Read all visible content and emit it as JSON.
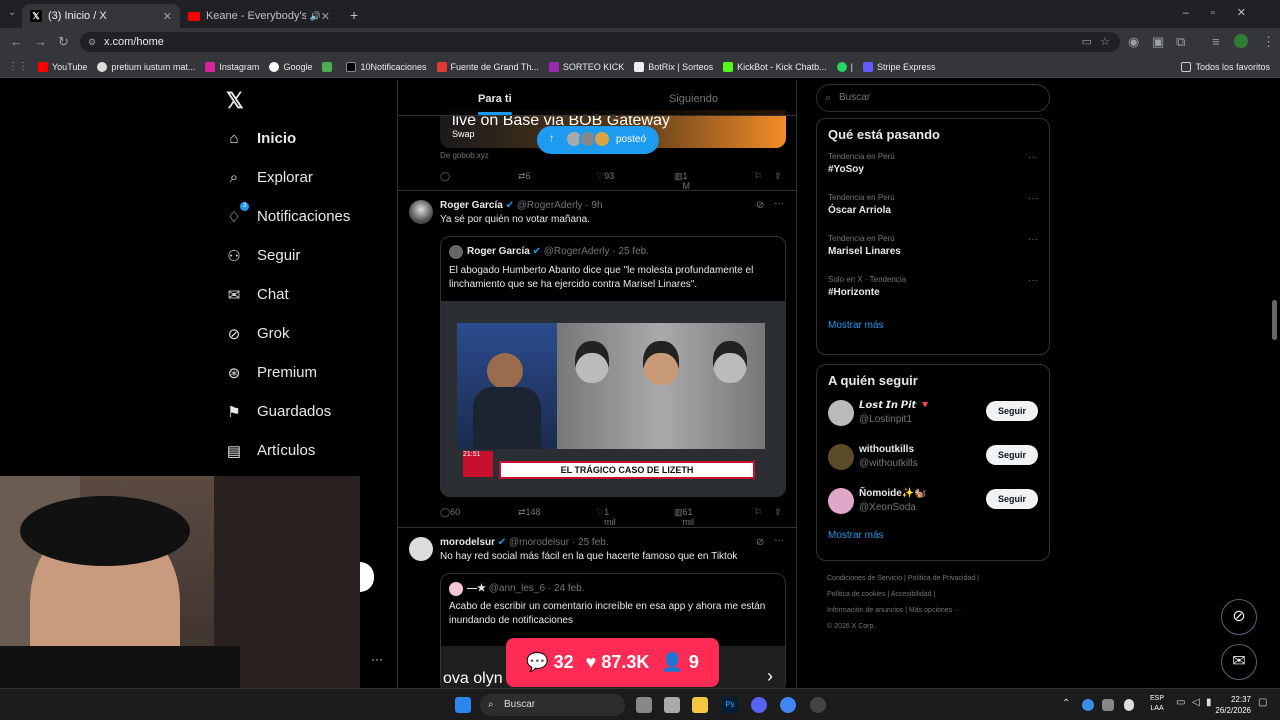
{
  "browser": {
    "tabs": [
      {
        "label": "(3) Inicio / X"
      },
      {
        "label": "Keane - Everybody's Chang"
      }
    ],
    "url": "x.com/home",
    "bookmarks": [
      "YouTube",
      "pretium iustum mat...",
      "Instagram",
      "Google",
      "10Notificaciones",
      "Fuente de Grand Th...",
      "SORTEO KICK",
      "BotRix | Sorteos",
      "KickBot - Kick Chatb...",
      "|",
      "Stripe Express"
    ],
    "all_bookmarks": "Todos los favoritos"
  },
  "nav": {
    "items": [
      {
        "label": "Inicio",
        "icon": "home-icon"
      },
      {
        "label": "Explorar",
        "icon": "search-icon"
      },
      {
        "label": "Notificaciones",
        "icon": "bell-icon",
        "badge": "3"
      },
      {
        "label": "Seguir",
        "icon": "person-add-icon"
      },
      {
        "label": "Chat",
        "icon": "mail-icon"
      },
      {
        "label": "Grok",
        "icon": "grok-icon"
      },
      {
        "label": "Premium",
        "icon": "premium-icon"
      },
      {
        "label": "Guardados",
        "icon": "bookmark-icon"
      },
      {
        "label": "Artículos",
        "icon": "articles-icon"
      }
    ]
  },
  "feed": {
    "tabs": [
      "Para ti",
      "Siguiendo"
    ],
    "posted_pill": "posteó",
    "tweet0": {
      "card_text": "live on Base via BOB Gateway",
      "card_sub": "Swap",
      "source": "De gobob.xyz",
      "retweets": "6",
      "likes": "93",
      "views": "1 M"
    },
    "tweet1": {
      "name": "Roger García",
      "handle": "@RogerAderly · 9h",
      "text": "Ya sé por quién no votar mañana.",
      "quote": {
        "name": "Roger García",
        "handle": "@RogerAderly · 25 feb.",
        "text": "El abogado Humberto Abanto dice que \"le molesta profundamente el linchamiento que se ha ejercido contra Marisel Linares\".",
        "image_caption": "EL TRÁGICO CASO DE LIZETH",
        "image_time": "21:51"
      },
      "replies": "60",
      "retweets": "148",
      "likes": "1 mil",
      "views": "61 mil"
    },
    "tweet2": {
      "name": "morodelsur",
      "handle": "@morodelsur · 25 feb.",
      "text": "No hay red social más fácil en la que hacerte famoso que en Tiktok",
      "quote": {
        "name": "—★",
        "handle": "@ann_les_6 · 24 feb.",
        "text": "Acabo de escribir un comentario increíble en esa app y ahora me están inundando de notificaciones",
        "partial": "ova olyn"
      }
    }
  },
  "right": {
    "search_placeholder": "Buscar",
    "trends_title": "Qué está pasando",
    "trends": [
      {
        "cat": "Tendencia en Perú",
        "name": "#YoSoy"
      },
      {
        "cat": "Tendencia en Perú",
        "name": "Óscar Arriola"
      },
      {
        "cat": "Tendencia en Perú",
        "name": "Marisel Linares"
      },
      {
        "cat": "Solo en X · Tendencia",
        "name": "#Horizonte"
      }
    ],
    "show_more": "Mostrar más",
    "who_title": "A quién seguir",
    "who": [
      {
        "name": "𝙇𝙤𝙨𝙩 𝙄𝙣 𝙋𝙞𝙩 🔻",
        "handle": "@Lostinpit1",
        "btn": "Seguir"
      },
      {
        "name": "withoutkills",
        "handle": "@withoutkills",
        "btn": "Seguir"
      },
      {
        "name": "Ñomoide✨🐿️",
        "handle": "@XeonSoda",
        "btn": "Seguir"
      }
    ],
    "show_more2": "Mostrar más",
    "footer": [
      "Condiciones de Servicio",
      "Política de Privacidad",
      "Política de cookies",
      "Accesibilidad",
      "Información de anuncios",
      "Más opciones ···",
      "© 2026 X Corp."
    ]
  },
  "overlay": {
    "comments": "32",
    "likes": "87.3K",
    "viewers": "9"
  },
  "taskbar": {
    "search": "Buscar",
    "lang1": "ESP",
    "lang2": "LAA",
    "time": "22:37",
    "date": "26/2/2026"
  }
}
